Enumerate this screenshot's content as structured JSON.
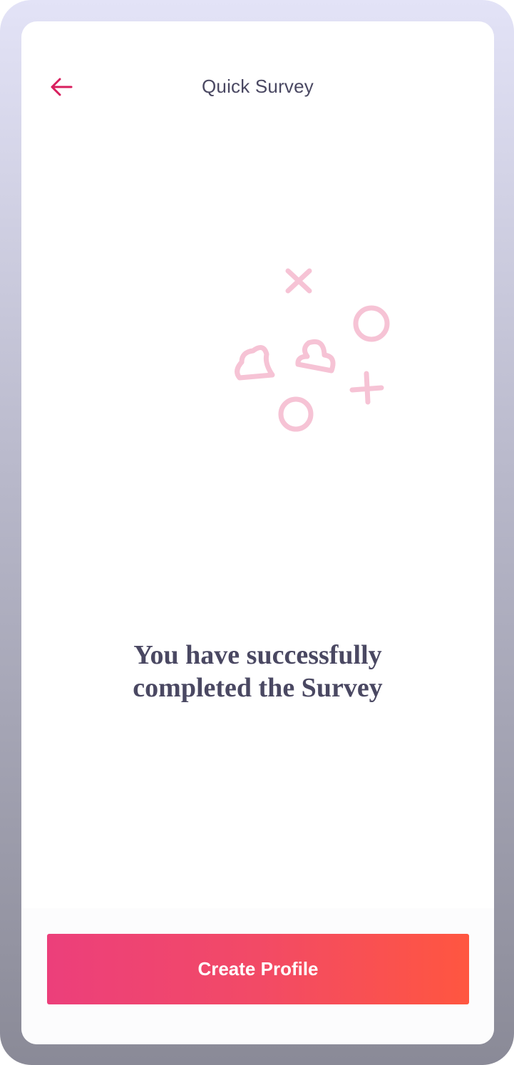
{
  "header": {
    "title": "Quick Survey",
    "back_icon": "arrow-left-icon"
  },
  "illustration": {
    "icons": [
      "x-mark-icon",
      "circle-icon",
      "heart-icon",
      "heart-icon",
      "plus-icon",
      "circle-icon"
    ],
    "color": "#f6c3d5"
  },
  "message": {
    "line1": "You have successfully",
    "line2": "completed the Survey"
  },
  "cta": {
    "label": "Create Profile"
  },
  "colors": {
    "accent": "#d81f5e",
    "gradient_start": "#ec3f7b",
    "gradient_end": "#ff5640",
    "text": "#4a4862"
  }
}
